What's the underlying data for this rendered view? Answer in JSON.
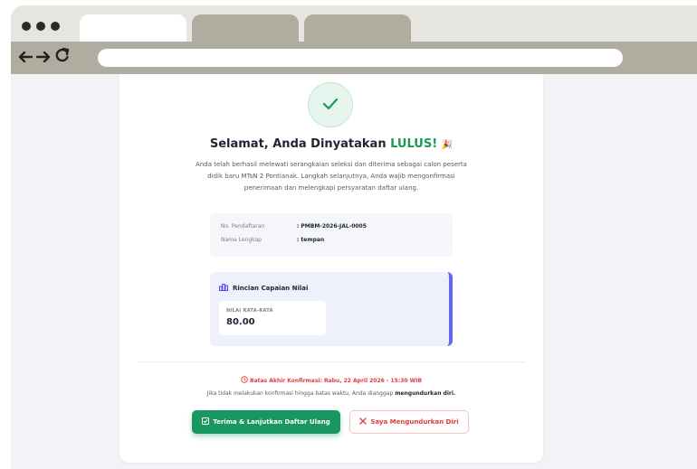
{
  "window": {
    "controls": [
      "close",
      "minimize",
      "maximize"
    ],
    "tabs": [
      {
        "label": "",
        "active": true
      },
      {
        "label": "",
        "active": false
      },
      {
        "label": "",
        "active": false
      }
    ]
  },
  "nav": {
    "back_icon": "arrow-left-icon",
    "forward_icon": "arrow-right-icon",
    "reload_icon": "reload-icon",
    "url": ""
  },
  "result": {
    "check_icon": "check-icon",
    "title_prefix": "Selamat, Anda Dinyatakan",
    "title_highlight": "LULUS!",
    "title_emoji": "🎉",
    "description": "Anda telah berhasil melewati serangkaian seleksi dan diterima sebagai calon peserta didik baru MTsN 2 Pontianak. Langkah selanjutnya, Anda wajib mengonfirmasi penerimaan dan melengkapi persyaratan daftar ulang."
  },
  "info": {
    "rows": [
      {
        "label": "No. Pendaftaran",
        "value": ": PMBM-2026-JAL-0005"
      },
      {
        "label": "Nama Lengkap",
        "value": ": tempan"
      }
    ]
  },
  "score": {
    "icon": "chart-icon",
    "title": "Rincian Capaian Nilai",
    "label": "NILAI RATA-RATA",
    "value": "80.00",
    "accent_color": "#6366f1"
  },
  "deadline": {
    "icon": "clock-icon",
    "text": "Batas Akhir Konfirmasi: Rabu, 22 April 2026 - 15:30 WIB"
  },
  "warning": {
    "text": "Jika tidak melakukan konfirmasi hingga batas waktu, Anda dianggap",
    "bold": "mengundurkan diri."
  },
  "actions": {
    "accept_icon": "checkbox-icon",
    "accept_label": "Terima & Lanjutkan Daftar Ulang",
    "resign_icon": "x-icon",
    "resign_label": "Saya Mengundurkan Diri",
    "accept_color": "#1a9660",
    "resign_color": "#e23b3b"
  }
}
